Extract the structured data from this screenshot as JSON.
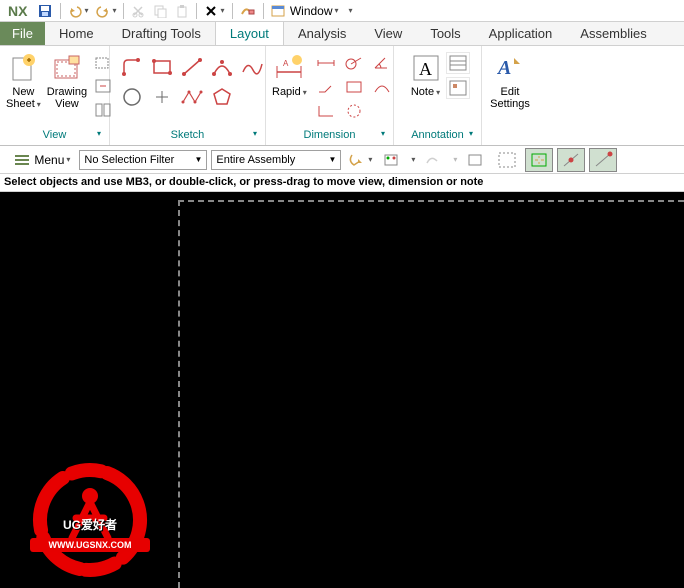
{
  "app": {
    "logo": "NX"
  },
  "titlebar": {
    "window_label": "Window"
  },
  "tabs": {
    "file": "File",
    "home": "Home",
    "drafting_tools": "Drafting Tools",
    "layout": "Layout",
    "analysis": "Analysis",
    "view": "View",
    "tools": "Tools",
    "application": "Application",
    "assemblies": "Assemblies"
  },
  "ribbon": {
    "new_sheet": "New Sheet",
    "drawing_view": "Drawing View",
    "view_group": "View",
    "sketch_group": "Sketch",
    "rapid": "Rapid",
    "dimension_group": "Dimension",
    "note": "Note",
    "annotation_group": "Annotation",
    "edit_settings": "Edit Settings"
  },
  "toolbar2": {
    "menu": "Menu",
    "filter": "No Selection Filter",
    "scope": "Entire Assembly"
  },
  "status": "Select objects and use MB3, or double-click, or press-drag to move view, dimension or note",
  "watermark": {
    "line1": "UG爱好者",
    "line2": "WWW.UGSNX.COM"
  }
}
